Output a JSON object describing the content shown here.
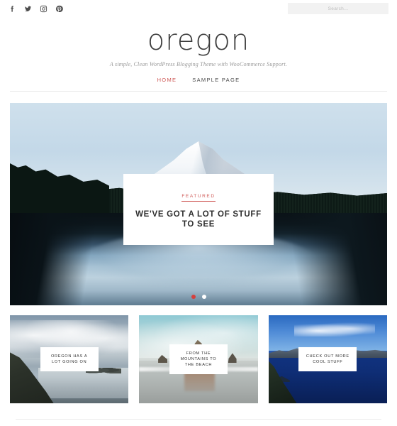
{
  "topbar": {
    "social": [
      {
        "name": "facebook-icon",
        "label": "Facebook"
      },
      {
        "name": "twitter-icon",
        "label": "Twitter"
      },
      {
        "name": "instagram-icon",
        "label": "Instagram"
      },
      {
        "name": "pinterest-icon",
        "label": "Pinterest"
      }
    ],
    "search": {
      "placeholder": "Search...",
      "value": ""
    }
  },
  "masthead": {
    "site_title": "oregon",
    "tagline": "A simple, Clean WordPress Blogging Theme with WooCommerce Support."
  },
  "nav": {
    "items": [
      {
        "label": "HOME",
        "active": true
      },
      {
        "label": "SAMPLE PAGE",
        "active": false
      }
    ]
  },
  "hero": {
    "featured_label": "FEATURED",
    "heading": "WE'VE GOT A LOT OF STUFF TO SEE",
    "slides_total": 2,
    "active_slide": 1,
    "image_description": "Snow-capped Mount Hood reflected in Trillium Lake with dark pine treeline"
  },
  "cards": [
    {
      "caption": "OREGON HAS A LOT GOING ON",
      "image_description": "Oregon coastline with cloudy sky and headland"
    },
    {
      "caption": "FROM THE MOUNTAINS TO THE BEACH",
      "image_description": "Haystack Rock at Cannon Beach with wet sand reflection"
    },
    {
      "caption": "CHECK OUT MORE COOL STUFF",
      "image_description": "Deep blue Crater Lake with caldera rim"
    }
  ],
  "colors": {
    "accent_red": "#cf5a57",
    "dot_active": "#d5403d",
    "text_dark": "#3a3a3a",
    "search_bg": "#f2f2f2",
    "divider": "#e8e8e8"
  }
}
